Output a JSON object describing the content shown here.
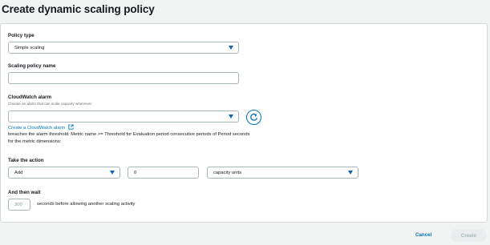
{
  "page": {
    "title": "Create dynamic scaling policy"
  },
  "policy_type": {
    "label": "Policy type",
    "value": "Simple scaling"
  },
  "scaling_policy_name": {
    "label": "Scaling policy name",
    "value": ""
  },
  "cloudwatch_alarm": {
    "label": "CloudWatch alarm",
    "hint": "Choose an alarm that can scale capacity whenever:",
    "value": "",
    "create_link": "Create a CloudWatch alarm",
    "description_line1": "breaches the alarm threshold: Metric name >= Threshold for Evaluation period consecutive periods of Period seconds",
    "description_line2": "for the metric dimensions:"
  },
  "action": {
    "label": "Take the action",
    "operation": "Add",
    "amount": "0",
    "unit": "capacity units"
  },
  "wait": {
    "label": "And then wait",
    "placeholder": "300",
    "suffix": "seconds before allowing another scaling activity"
  },
  "footer": {
    "cancel_label": "Cancel",
    "create_label": "Create"
  },
  "colors": {
    "accent": "#0073bb",
    "border": "#aab7b8",
    "background": "#f2f3f3"
  },
  "icons": {
    "refresh": "refresh-icon",
    "external": "external-link-icon",
    "dropdown": "caret-down-icon"
  }
}
